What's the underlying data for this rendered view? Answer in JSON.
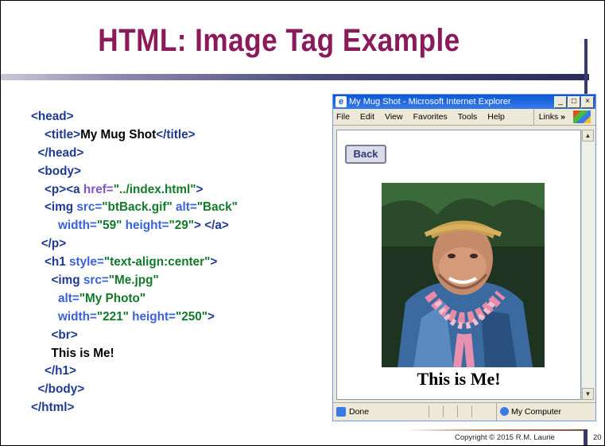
{
  "slide": {
    "title": "HTML: Image Tag Example",
    "copyright": "Copyright © 2015  R.M. Laurie",
    "page_number": "20"
  },
  "code_lines": [
    [
      {
        "t": "tag",
        "s": "<head>"
      }
    ],
    [
      {
        "t": "tag",
        "s": "    <title>"
      },
      {
        "t": "txt",
        "s": "My Mug Shot"
      },
      {
        "t": "tag",
        "s": "</title>"
      }
    ],
    [
      {
        "t": "tag",
        "s": "  </head>"
      }
    ],
    [
      {
        "t": "tag",
        "s": "  <body>"
      }
    ],
    [
      {
        "t": "tag",
        "s": "    <p><a "
      },
      {
        "t": "href",
        "s": "href="
      },
      {
        "t": "val",
        "s": "\"../index.html\""
      },
      {
        "t": "tag",
        "s": ">"
      }
    ],
    [
      {
        "t": "tag",
        "s": "    <img "
      },
      {
        "t": "attr",
        "s": "src="
      },
      {
        "t": "val",
        "s": "\"btBack.gif\""
      },
      {
        "t": "attr",
        "s": " alt="
      },
      {
        "t": "val",
        "s": "\"Back\""
      }
    ],
    [
      {
        "t": "attr",
        "s": "        width="
      },
      {
        "t": "val",
        "s": "\"59\""
      },
      {
        "t": "attr",
        "s": " height="
      },
      {
        "t": "val",
        "s": "\"29\""
      },
      {
        "t": "tag",
        "s": "> </a>"
      }
    ],
    [
      {
        "t": "tag",
        "s": "   </p>"
      }
    ],
    [
      {
        "t": "tag",
        "s": "    <h1 "
      },
      {
        "t": "attr",
        "s": "style="
      },
      {
        "t": "val",
        "s": "\"text-align:center\""
      },
      {
        "t": "tag",
        "s": ">"
      }
    ],
    [
      {
        "t": "tag",
        "s": "      <img "
      },
      {
        "t": "attr",
        "s": "src="
      },
      {
        "t": "val",
        "s": "\"Me.jpg\""
      }
    ],
    [
      {
        "t": "attr",
        "s": "        alt="
      },
      {
        "t": "val",
        "s": "\"My Photo\""
      }
    ],
    [
      {
        "t": "attr",
        "s": "        width="
      },
      {
        "t": "val",
        "s": "\"221\""
      },
      {
        "t": "attr",
        "s": " height="
      },
      {
        "t": "val",
        "s": "\"250\""
      },
      {
        "t": "tag",
        "s": ">"
      }
    ],
    [
      {
        "t": "tag",
        "s": "      <br>"
      }
    ],
    [
      {
        "t": "txt",
        "s": "      This is Me!"
      }
    ],
    [
      {
        "t": "tag",
        "s": "    </h1>"
      }
    ],
    [
      {
        "t": "tag",
        "s": "  </body>"
      }
    ],
    [
      {
        "t": "tag",
        "s": "</html>"
      }
    ]
  ],
  "browser": {
    "window_title": "My Mug Shot - Microsoft Internet Explorer",
    "menu": [
      "File",
      "Edit",
      "View",
      "Favorites",
      "Tools",
      "Help"
    ],
    "links_label": "Links",
    "links_chevron": "»",
    "back_button": "Back",
    "caption": "This is Me!",
    "status_done": "Done",
    "status_zone": "My Computer",
    "window_buttons": {
      "minimize": "_",
      "maximize": "□",
      "close": "×"
    }
  },
  "colors": {
    "title": "#8b1a5a",
    "tag": "#1f3a93",
    "attribute": "#3a62d8",
    "value": "#127a2a",
    "href_attribute": "#7a55c8"
  }
}
